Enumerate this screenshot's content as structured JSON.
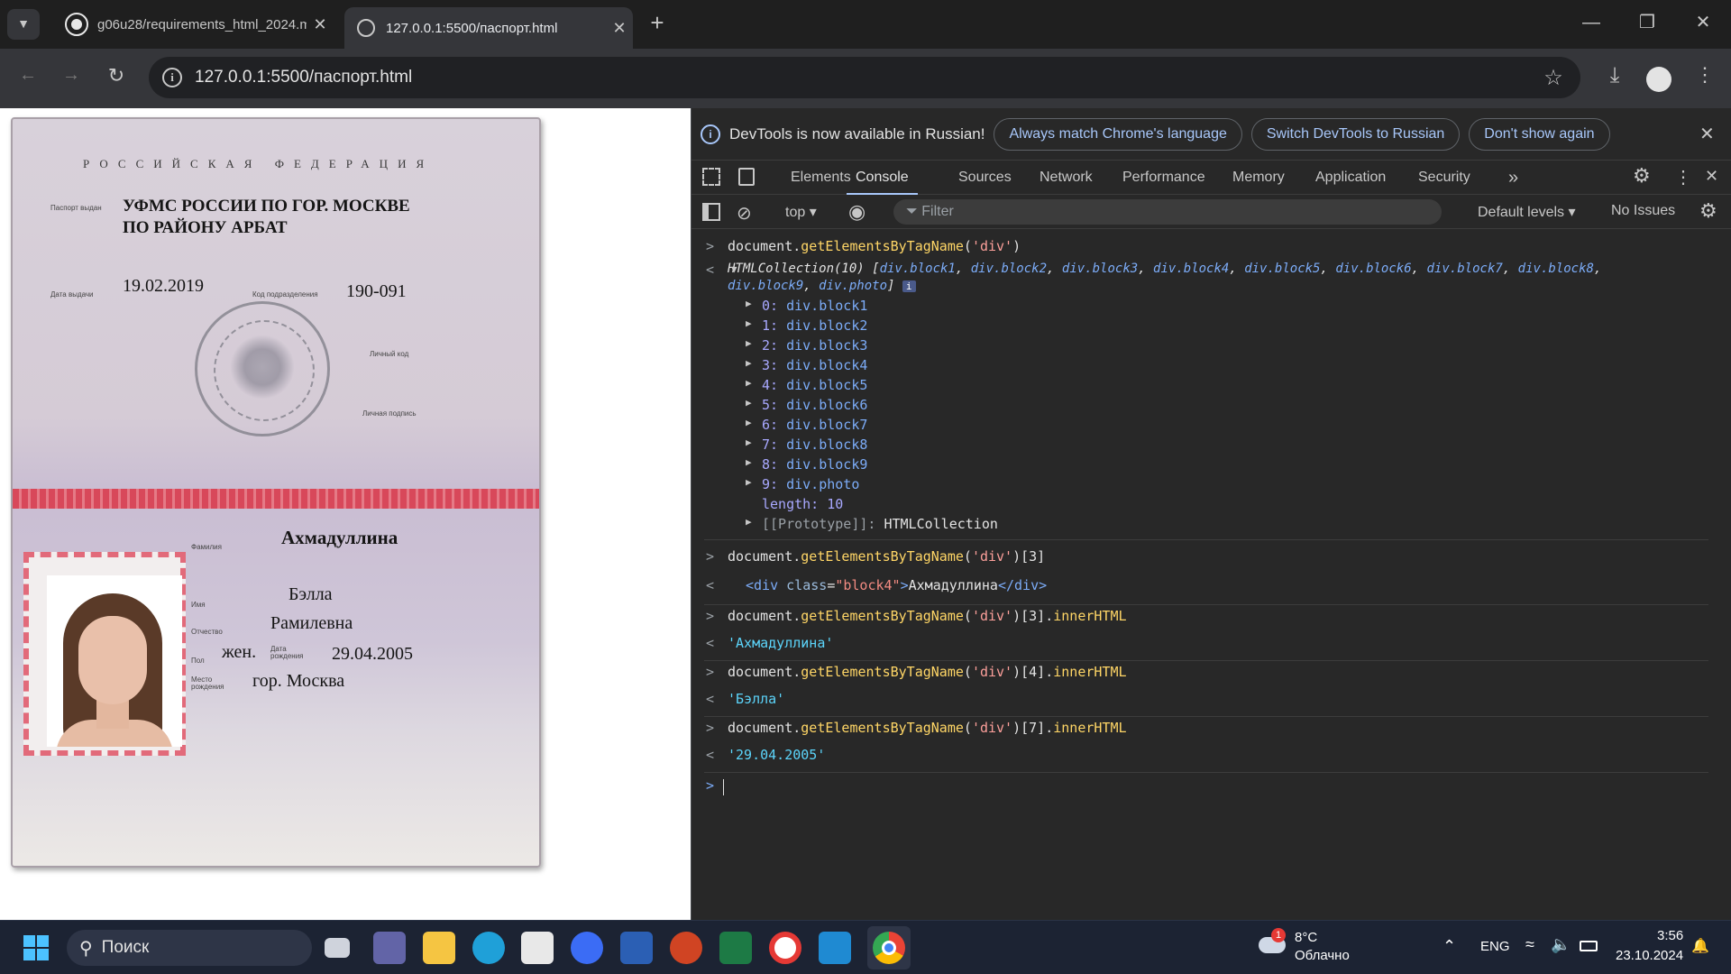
{
  "browser": {
    "tabs": [
      {
        "title": "g06u28/requirements_html_2024.m",
        "active": false
      },
      {
        "title": "127.0.0.1:5500/паспорт.html",
        "active": true
      }
    ],
    "new_tab": "+",
    "url": "127.0.0.1:5500/паспорт.html"
  },
  "passport": {
    "header": "РОССИЙСКАЯ ФЕДЕРАЦИЯ",
    "issued_label": "Паспорт выдан",
    "issuer_line1": "УФМС РОССИИ ПО ГОР. МОСКВЕ",
    "issuer_line2": "ПО РАЙОНУ АРБАТ",
    "issue_date_label": "Дата выдачи",
    "issue_date": "19.02.2019",
    "division_label": "Код подразделения",
    "division_code": "190-091",
    "personal_sign_label": "Личный код",
    "signature_label": "Личная подпись",
    "surname_label": "Фамилия",
    "surname": "Ахмадуллина",
    "name_label": "Имя",
    "name": "Бэлла",
    "patronymic_label": "Отчество",
    "patronymic": "Рамилевна",
    "sex_label": "Пол",
    "sex": "жен.",
    "dob_label": "Дата рождения",
    "dob": "29.04.2005",
    "pob_label": "Место рождения",
    "pob": "гор. Москва"
  },
  "devtools": {
    "infobar": {
      "message": "DevTools is now available in Russian!",
      "buttons": [
        "Always match Chrome's language",
        "Switch DevTools to Russian",
        "Don't show again"
      ]
    },
    "tabs": [
      "Elements",
      "Console",
      "Sources",
      "Network",
      "Performance",
      "Memory",
      "Application",
      "Security"
    ],
    "active_tab": "Console",
    "context": "top",
    "filter_placeholder": "Filter",
    "levels": "Default levels",
    "issues": "No Issues",
    "console": {
      "cmd1": {
        "obj": "document.",
        "fn": "getElementsByTagName",
        "arg": "'div'",
        "tail": ""
      },
      "collection_head": "HTMLCollection(10) [",
      "collection_items_line1": [
        "div.block1",
        "div.block2",
        "div.block3",
        "div.block4",
        "div.block5",
        "div.block6",
        "div.block7",
        "div.block8"
      ],
      "collection_items_line2": [
        "div.block9",
        "div.photo"
      ],
      "entries": [
        {
          "idx": "0:",
          "val": "div.block1"
        },
        {
          "idx": "1:",
          "val": "div.block2"
        },
        {
          "idx": "2:",
          "val": "div.block3"
        },
        {
          "idx": "3:",
          "val": "div.block4"
        },
        {
          "idx": "4:",
          "val": "div.block5"
        },
        {
          "idx": "5:",
          "val": "div.block6"
        },
        {
          "idx": "6:",
          "val": "div.block7"
        },
        {
          "idx": "7:",
          "val": "div.block8"
        },
        {
          "idx": "8:",
          "val": "div.block9"
        },
        {
          "idx": "9:",
          "val": "div.photo"
        }
      ],
      "length_label": "length:",
      "length_value": "10",
      "prototype_label": "[[Prototype]]:",
      "prototype_value": "HTMLCollection",
      "cmd2_tail": "[3]",
      "result2_tag_open": "<div ",
      "result2_attr": "class",
      "result2_attr_val": "\"block4\"",
      "result2_text": "Ахмадуллина",
      "result2_tag_close": "</div>",
      "cmd3_tail": "[3].",
      "cmd4_tail": "[4].",
      "cmd5_tail": "[7].",
      "inner": "innerHTML",
      "result3": "'Ахмадуллина'",
      "result4": "'Бэлла'",
      "result5": "'29.04.2005'"
    }
  },
  "taskbar": {
    "search": "Поиск",
    "weather_temp": "8°C",
    "weather_desc": "Облачно",
    "weather_badge": "1",
    "lang": "ENG",
    "time": "3:56",
    "date": "23.10.2024"
  }
}
